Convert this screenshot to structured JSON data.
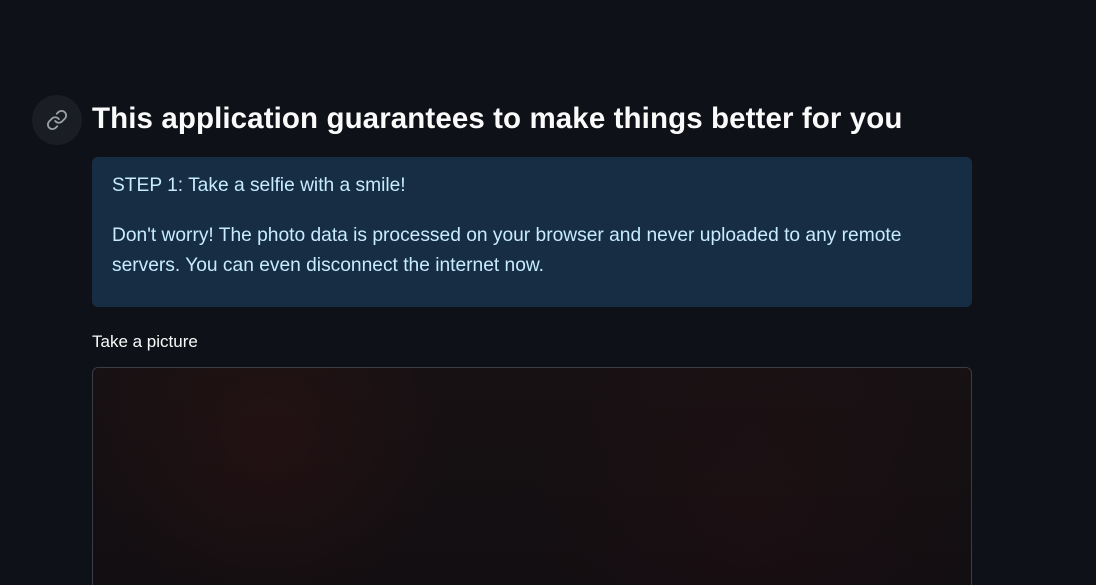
{
  "header": {
    "anchor_icon": "link-icon",
    "title": "This application guarantees to make things better for you"
  },
  "info": {
    "step": "STEP 1: Take a selfie with a smile!",
    "message": "Don't worry! The photo data is processed on your browser and never uploaded to any remote servers. You can even disconnect the internet now."
  },
  "camera": {
    "label": "Take a picture"
  },
  "colors": {
    "background": "#0e1117",
    "info_background": "#172d43",
    "info_text": "#c7ebff",
    "text": "#fafafa"
  }
}
